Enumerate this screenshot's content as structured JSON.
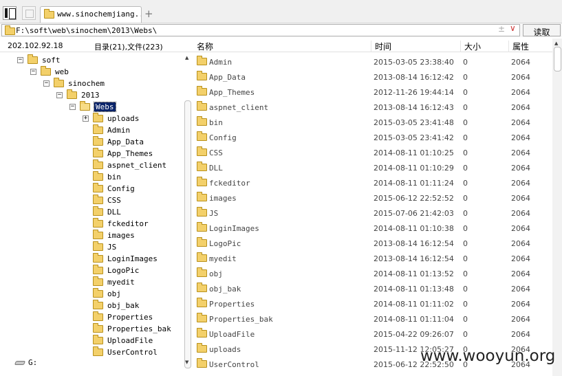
{
  "tab": {
    "title": "www.sinochemjiang..."
  },
  "address": {
    "path": "F:\\soft\\web\\sinochem\\2013\\Webs\\",
    "read_button": "读取"
  },
  "info": {
    "ip": "202.102.92.18",
    "counts": "目录(21),文件(223)"
  },
  "columns": {
    "name": "名称",
    "time": "时间",
    "size": "大小",
    "attr": "属性"
  },
  "tree": {
    "ancestors": [
      {
        "label": "soft",
        "expander": "−"
      },
      {
        "label": "web",
        "expander": "−"
      },
      {
        "label": "sinochem",
        "expander": "−"
      },
      {
        "label": "2013",
        "expander": "−"
      },
      {
        "label": "Webs",
        "expander": "−"
      }
    ],
    "children": [
      {
        "label": "uploads",
        "expander": "+"
      },
      {
        "label": "Admin"
      },
      {
        "label": "App_Data"
      },
      {
        "label": "App_Themes"
      },
      {
        "label": "aspnet_client"
      },
      {
        "label": "bin"
      },
      {
        "label": "Config"
      },
      {
        "label": "CSS"
      },
      {
        "label": "DLL"
      },
      {
        "label": "fckeditor"
      },
      {
        "label": "images"
      },
      {
        "label": "JS"
      },
      {
        "label": "LoginImages"
      },
      {
        "label": "LogoPic"
      },
      {
        "label": "myedit"
      },
      {
        "label": "obj"
      },
      {
        "label": "obj_bak"
      },
      {
        "label": "Properties"
      },
      {
        "label": "Properties_bak"
      },
      {
        "label": "UploadFile"
      },
      {
        "label": "UserControl"
      }
    ],
    "drive": "G:"
  },
  "files": [
    {
      "name": "Admin",
      "time": "2015-03-05 23:38:40",
      "size": "0",
      "attr": "2064"
    },
    {
      "name": "App_Data",
      "time": "2013-08-14 16:12:42",
      "size": "0",
      "attr": "2064"
    },
    {
      "name": "App_Themes",
      "time": "2012-11-26 19:44:14",
      "size": "0",
      "attr": "2064"
    },
    {
      "name": "aspnet_client",
      "time": "2013-08-14 16:12:43",
      "size": "0",
      "attr": "2064"
    },
    {
      "name": "bin",
      "time": "2015-03-05 23:41:48",
      "size": "0",
      "attr": "2064"
    },
    {
      "name": "Config",
      "time": "2015-03-05 23:41:42",
      "size": "0",
      "attr": "2064"
    },
    {
      "name": "CSS",
      "time": "2014-08-11 01:10:25",
      "size": "0",
      "attr": "2064"
    },
    {
      "name": "DLL",
      "time": "2014-08-11 01:10:29",
      "size": "0",
      "attr": "2064"
    },
    {
      "name": "fckeditor",
      "time": "2014-08-11 01:11:24",
      "size": "0",
      "attr": "2064"
    },
    {
      "name": "images",
      "time": "2015-06-12 22:52:52",
      "size": "0",
      "attr": "2064"
    },
    {
      "name": "JS",
      "time": "2015-07-06 21:42:03",
      "size": "0",
      "attr": "2064"
    },
    {
      "name": "LoginImages",
      "time": "2014-08-11 01:10:38",
      "size": "0",
      "attr": "2064"
    },
    {
      "name": "LogoPic",
      "time": "2013-08-14 16:12:54",
      "size": "0",
      "attr": "2064"
    },
    {
      "name": "myedit",
      "time": "2013-08-14 16:12:54",
      "size": "0",
      "attr": "2064"
    },
    {
      "name": "obj",
      "time": "2014-08-11 01:13:52",
      "size": "0",
      "attr": "2064"
    },
    {
      "name": "obj_bak",
      "time": "2014-08-11 01:13:48",
      "size": "0",
      "attr": "2064"
    },
    {
      "name": "Properties",
      "time": "2014-08-11 01:11:02",
      "size": "0",
      "attr": "2064"
    },
    {
      "name": "Properties_bak",
      "time": "2014-08-11 01:11:04",
      "size": "0",
      "attr": "2064"
    },
    {
      "name": "UploadFile",
      "time": "2015-04-22 09:26:07",
      "size": "0",
      "attr": "2064"
    },
    {
      "name": "uploads",
      "time": "2015-11-12 12:05:27",
      "size": "0",
      "attr": "2064"
    },
    {
      "name": "UserControl",
      "time": "2015-06-12 22:52:50",
      "size": "0",
      "attr": "2064"
    }
  ],
  "watermark": "www.wooyun.org",
  "colors": {
    "folder": "#f3d06a",
    "selection": "#0a246a"
  }
}
